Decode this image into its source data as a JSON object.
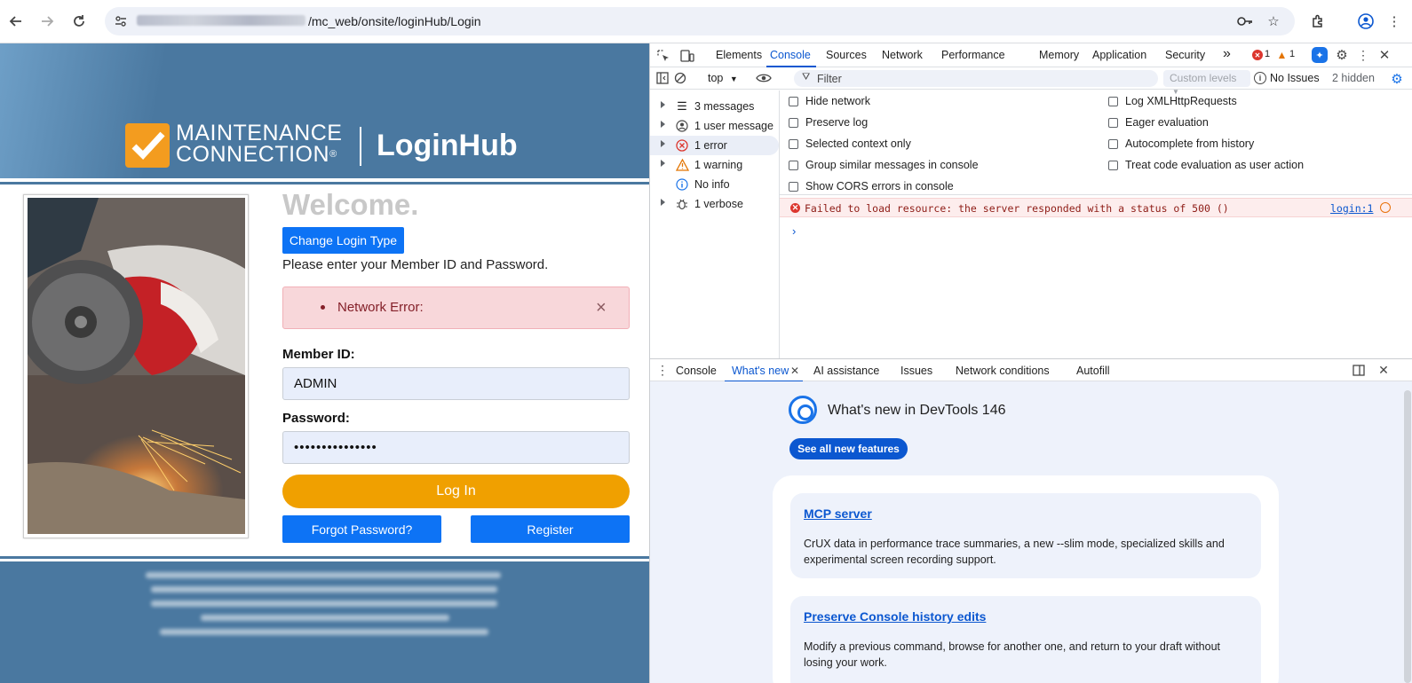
{
  "browser": {
    "url_path": "/mc_web/onsite/loginHub/Login"
  },
  "page": {
    "logo_line1": "MAINTENANCE",
    "logo_line2": "CONNECTION",
    "logo_reg": "®",
    "logo_hub": "LoginHub",
    "welcome": "Welcome.",
    "change_login_type": "Change Login Type",
    "instructions": "Please enter your Member ID and Password.",
    "alert_text": "Network Error:",
    "alert_close": "×",
    "member_id_label": "Member ID:",
    "member_id_value": "ADMIN",
    "password_label": "Password:",
    "password_value": "•••••••••••••••",
    "login_button": "Log In",
    "forgot_password": "Forgot Password?",
    "register": "Register"
  },
  "devtools": {
    "tabs": [
      "Elements",
      "Console",
      "Sources",
      "Network",
      "Performance",
      "Memory",
      "Application",
      "Security"
    ],
    "more_tabs": "»",
    "error_count": "1",
    "warning_count": "1",
    "context": "top",
    "filter_placeholder": "Filter",
    "levels": "Custom levels",
    "no_issues": "No Issues",
    "hidden": "2 hidden",
    "sidebar": [
      {
        "label": "3 messages",
        "icon": "list-icon"
      },
      {
        "label": "1 user message",
        "icon": "user-icon"
      },
      {
        "label": "1 error",
        "icon": "error-icon"
      },
      {
        "label": "1 warning",
        "icon": "warning-icon"
      },
      {
        "label": "No info",
        "icon": "info-icon"
      },
      {
        "label": "1 verbose",
        "icon": "bug-icon"
      }
    ],
    "settings_left": [
      "Hide network",
      "Preserve log",
      "Selected context only",
      "Group similar messages in console",
      "Show CORS errors in console"
    ],
    "settings_right": [
      "Log XMLHttpRequests",
      "Eager evaluation",
      "Autocomplete from history",
      "Treat code evaluation as user action"
    ],
    "error_message": "Failed to load resource: the server responded with a status of 500 ()",
    "error_source": "login:1",
    "drawer_tabs": [
      "Console",
      "What's new",
      "AI assistance",
      "Issues",
      "Network conditions",
      "Autofill"
    ],
    "whats_new_title": "What's new in DevTools 146",
    "see_all": "See all new features",
    "cards": [
      {
        "title": "MCP server",
        "desc": "CrUX data in performance trace summaries, a new --slim mode, specialized skills and experimental screen recording support."
      },
      {
        "title": "Preserve Console history edits",
        "desc": "Modify a previous command, browse for another one, and return to your draft without losing your work."
      }
    ]
  },
  "colors": {
    "banner_blue": "#4a78a0",
    "brand_orange": "#f39c1f",
    "primary_blue": "#0d73f5",
    "login_orange": "#f0a000",
    "devtools_accent": "#0b57d0",
    "error_red": "#dc362e"
  }
}
